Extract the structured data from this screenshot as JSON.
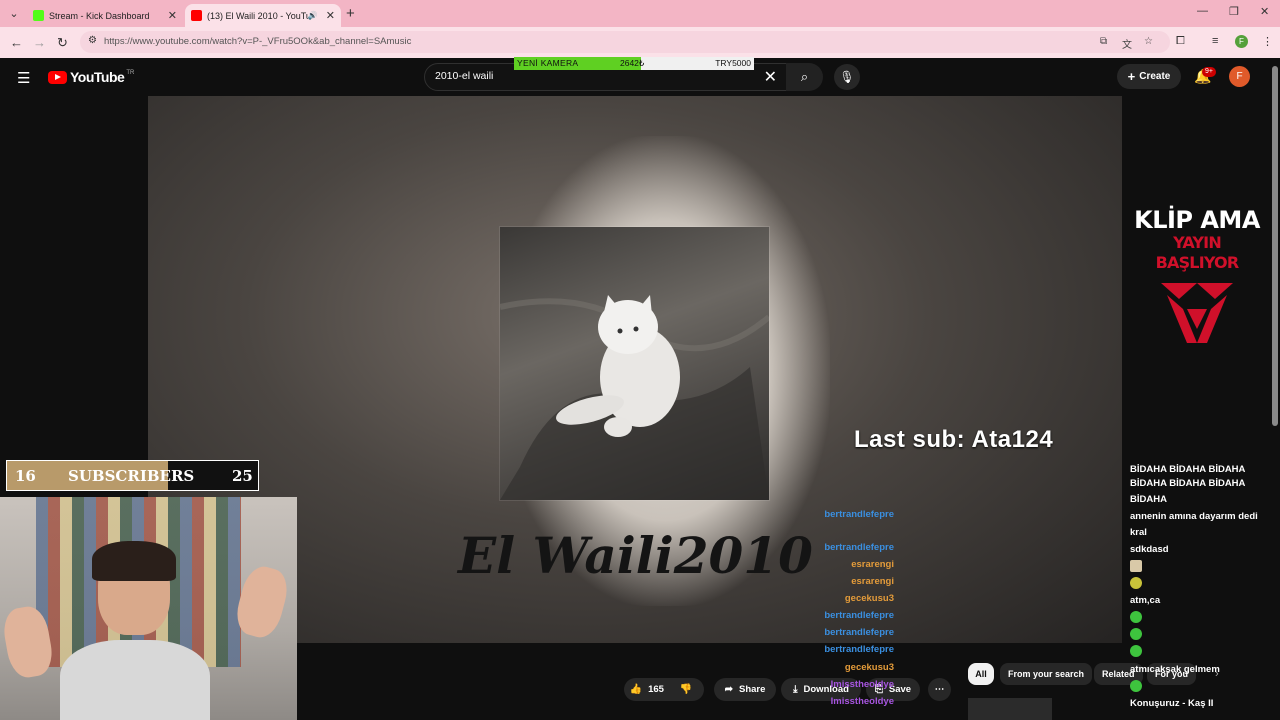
{
  "browser": {
    "tabs": [
      {
        "title": "Stream - Kick Dashboard",
        "favicon_color": "#53fc18"
      },
      {
        "title": "(13) El Waili 2010 - YouTube",
        "favicon_color": "#ff0000"
      }
    ],
    "url_display": "https://www.youtube.com/watch?v=P-_VFru5OOk&ab_channel=SAmusic",
    "profile_initial": "F"
  },
  "youtube": {
    "logo_text": "YouTube",
    "country_code": "TR",
    "search_query": "2010-el waili",
    "create_label": "Create",
    "notifications_badge": "9+",
    "avatar_initial": "F"
  },
  "stream_overlay": {
    "goal_label": "YENİ KAMERA",
    "goal_current": "2642₺",
    "goal_target": "TRY5000",
    "goal_progress": 0.53,
    "subs_current": "16",
    "subs_label": "SUBSCRIBERS",
    "subs_target": "25",
    "subs_progress": 0.64,
    "last_sub": "Last sub: Ata124",
    "klip_line1": "KLİP AMA",
    "klip_line2": "YAYIN BAŞLIYOR"
  },
  "video": {
    "caption": "El Waili2010"
  },
  "actions": {
    "likes": "165",
    "share_label": "Share",
    "download_label": "Download",
    "save_label": "Save"
  },
  "chips": [
    "All",
    "From your search",
    "Related",
    "For you"
  ],
  "chat": [
    {
      "user": "",
      "message": "BİDAHA BİDAHA BİDAHA",
      "color": "#ffffff"
    },
    {
      "user": "",
      "message": "BİDAHA BİDAHA BİDAHA",
      "color": "#ffffff"
    },
    {
      "user": "",
      "message": "BİDAHA",
      "color": "#ffffff"
    },
    {
      "user": "bertrandlefepre",
      "message": "annenin amına dayarım dedi",
      "color": "#3a8fe0"
    },
    {
      "user": "",
      "message": "kral",
      "color": "#ffffff"
    },
    {
      "user": "bertrandlefepre",
      "message": "sdkdasd",
      "color": "#3a8fe0"
    },
    {
      "user": "esrarengi",
      "message": "",
      "color": "#e39b3a"
    },
    {
      "user": "esrarengi",
      "message": "",
      "color": "#e39b3a"
    },
    {
      "user": "gecekusu3",
      "message": "atm,ca",
      "color": "#e39b3a"
    },
    {
      "user": "bertrandlefepre",
      "message": "",
      "color": "#3a8fe0"
    },
    {
      "user": "bertrandlefepre",
      "message": "",
      "color": "#3a8fe0"
    },
    {
      "user": "bertrandlefepre",
      "message": "",
      "color": "#3a8fe0"
    },
    {
      "user": "gecekusu3",
      "message": "atmıcaksak gelmem",
      "color": "#e39b3a"
    },
    {
      "user": "Imisstheoldye",
      "message": "",
      "color": "#a755e0"
    },
    {
      "user": "Imisstheoldye",
      "message": "Konuşuruz - Kaş II",
      "color": "#a755e0"
    }
  ]
}
